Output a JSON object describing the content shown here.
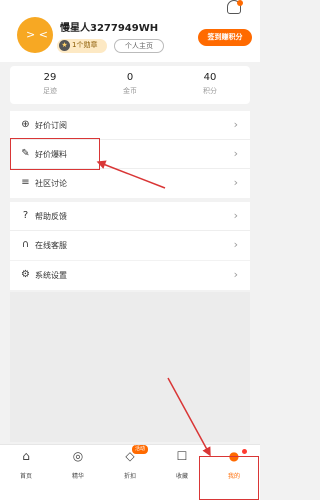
{
  "profile": {
    "username": "慢星人3277949WH",
    "badge_label": "1个勋章",
    "homepage_label": "个人主页",
    "checkin_label": "签到赚积分",
    "avatar_face": "> <"
  },
  "stats": [
    {
      "value": "29",
      "label": "足迹"
    },
    {
      "value": "0",
      "label": "金币"
    },
    {
      "value": "40",
      "label": "积分"
    }
  ],
  "menu_group_1": [
    {
      "label": "好价订阅",
      "icon": "plus-circle-icon"
    },
    {
      "label": "好价爆料",
      "icon": "pencil-icon"
    },
    {
      "label": "社区讨论",
      "icon": "chat-icon"
    }
  ],
  "menu_group_2": [
    {
      "label": "帮助反馈",
      "icon": "help-icon"
    },
    {
      "label": "在线客服",
      "icon": "headset-icon"
    }
  ],
  "menu_group_3": [
    {
      "label": "系统设置",
      "icon": "settings-icon"
    }
  ],
  "chevron": "›",
  "tabs": [
    {
      "label": "首页",
      "icon": "home-icon"
    },
    {
      "label": "精华",
      "icon": "essence-icon"
    },
    {
      "label": "折扣",
      "icon": "tag-icon",
      "badge": "活动"
    },
    {
      "label": "收藏",
      "icon": "collect-icon"
    },
    {
      "label": "我的",
      "icon": "profile-icon",
      "active": true
    }
  ],
  "colors": {
    "accent": "#ff6a00",
    "highlight": "#d93636"
  }
}
